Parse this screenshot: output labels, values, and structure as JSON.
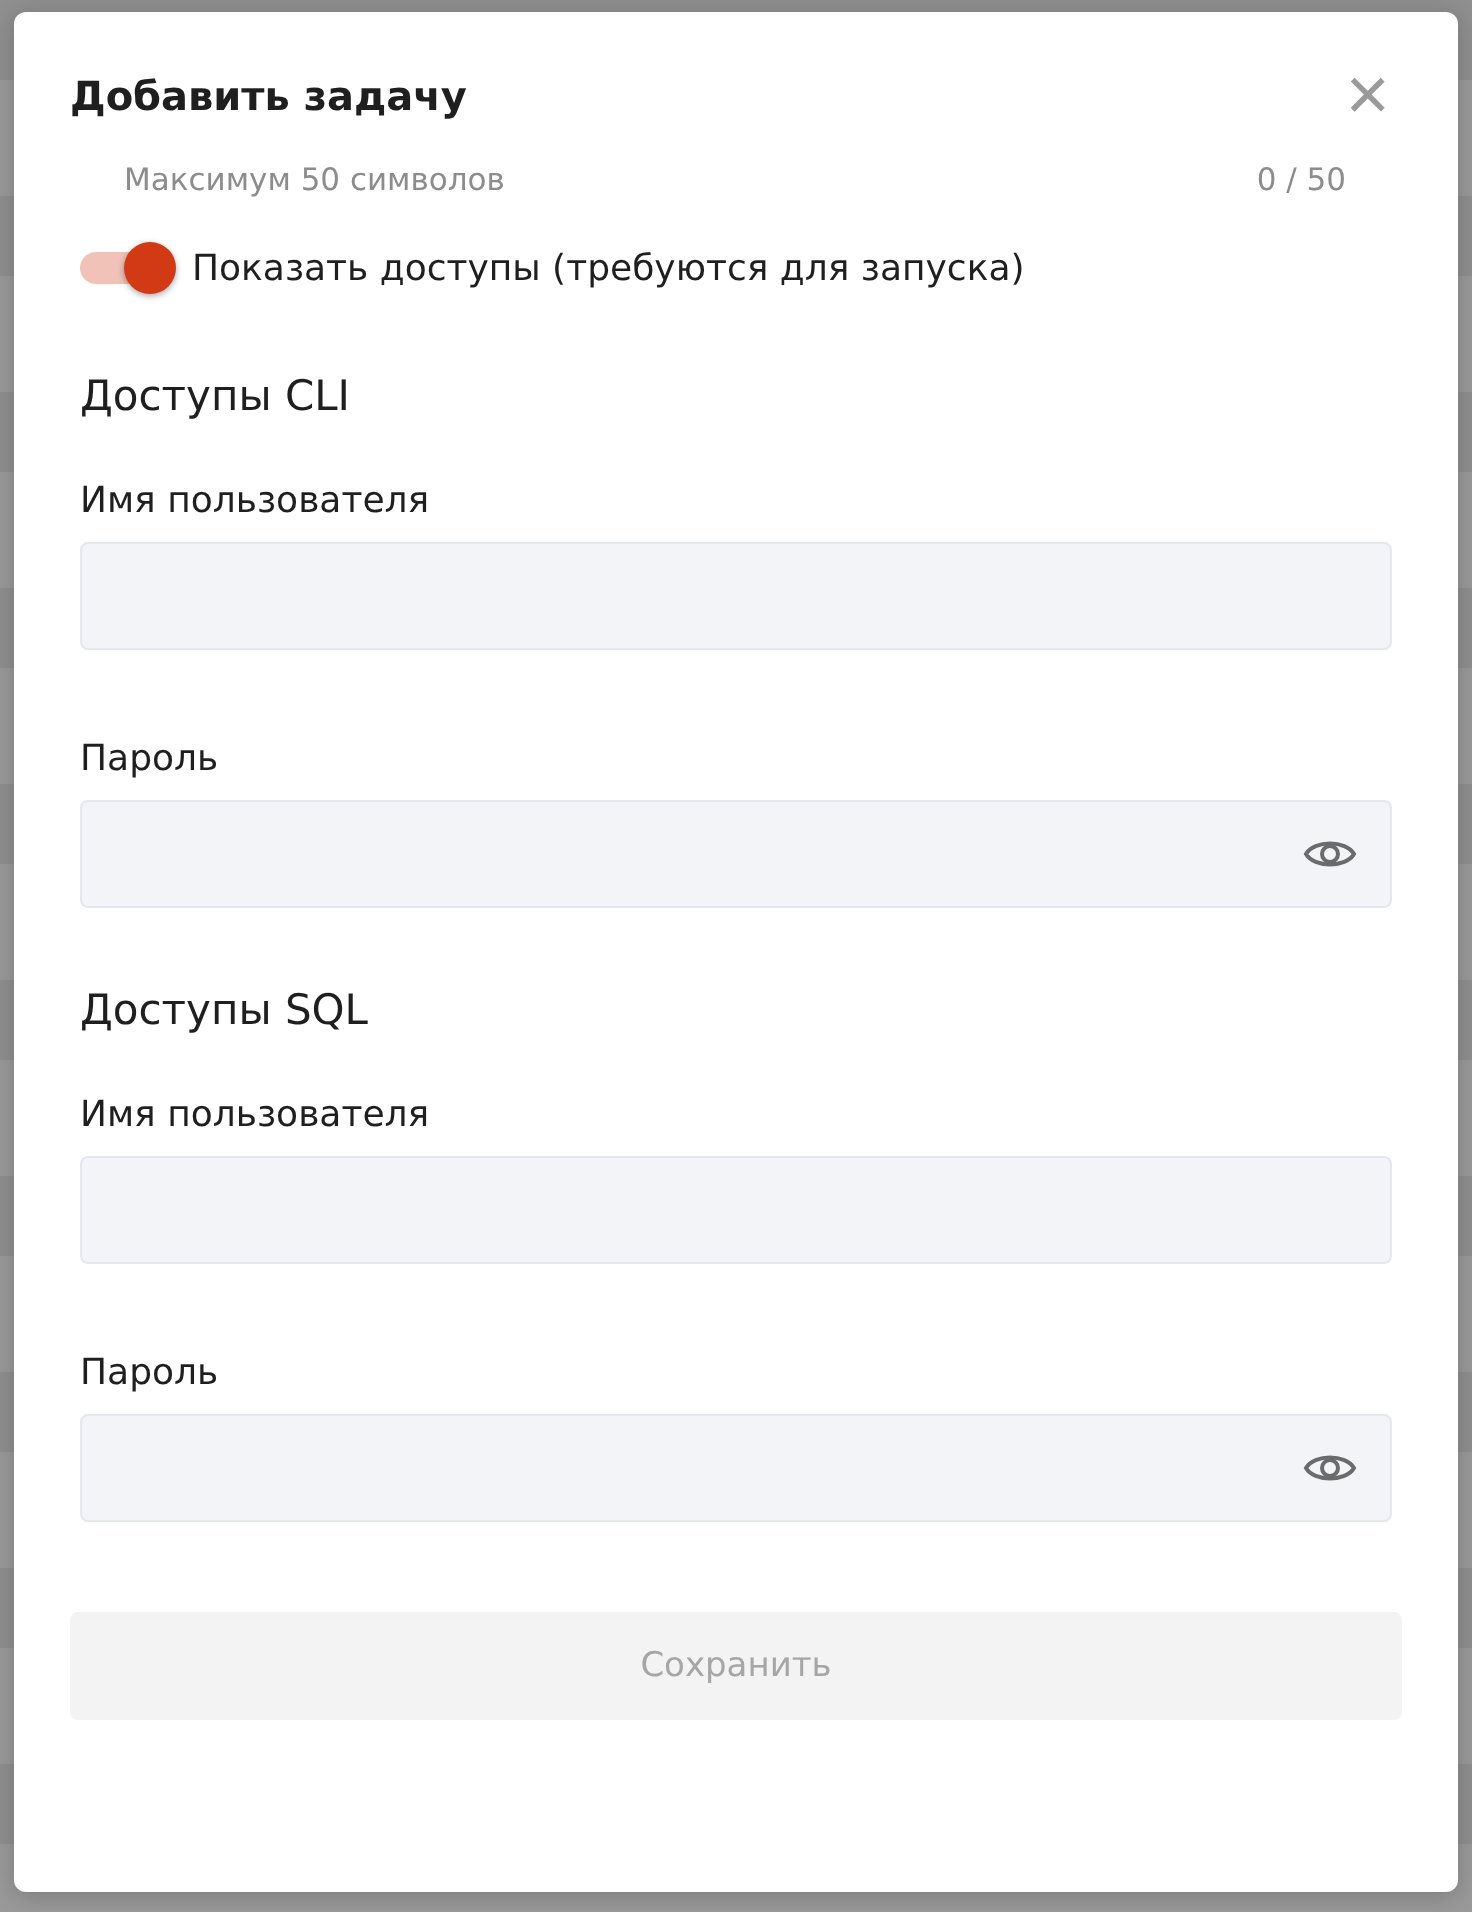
{
  "dialog": {
    "title": "Добавить задачу",
    "close_icon": "×"
  },
  "name_hint": {
    "hint": "Максимум 50 символов",
    "counter": "0 / 50"
  },
  "toggle": {
    "label": "Показать доступы (требуются для запуска)",
    "on": true
  },
  "sections": [
    {
      "title": "Доступы CLI",
      "fields": [
        {
          "label": "Имя пользователя",
          "kind": "text"
        },
        {
          "label": "Пароль",
          "kind": "password"
        }
      ]
    },
    {
      "title": "Доступы SQL",
      "fields": [
        {
          "label": "Имя пользователя",
          "kind": "text"
        },
        {
          "label": "Пароль",
          "kind": "password"
        }
      ]
    }
  ],
  "save_button": {
    "label": "Сохранить",
    "disabled": true
  }
}
